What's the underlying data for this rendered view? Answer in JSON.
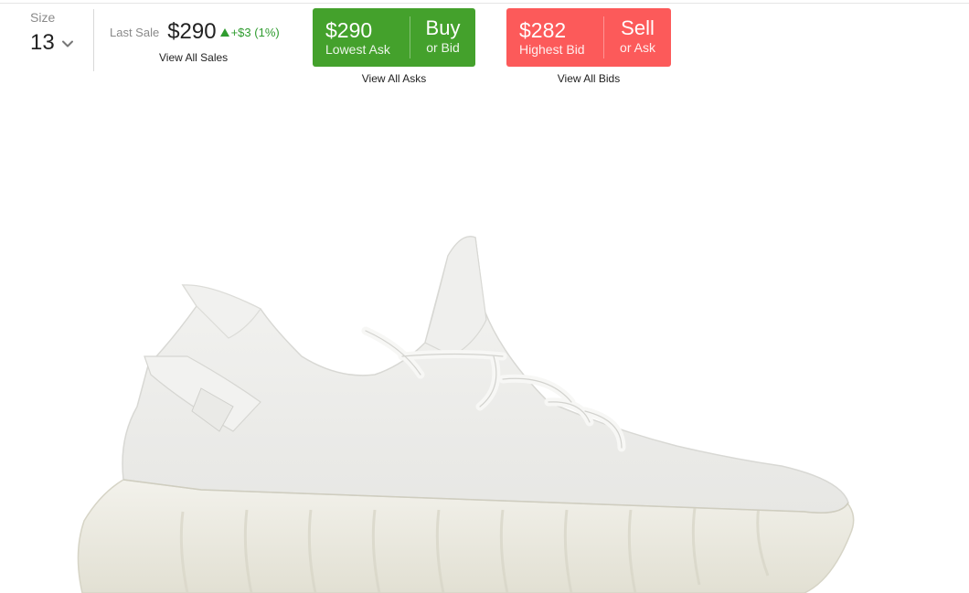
{
  "size": {
    "label": "Size",
    "value": "13",
    "icon": "chevron-down-icon"
  },
  "last_sale": {
    "label": "Last Sale",
    "price": "$290",
    "change": "+$3 (1%)",
    "direction": "up",
    "link": "View All Sales"
  },
  "buy": {
    "price": "$290",
    "price_label": "Lowest Ask",
    "action": "Buy",
    "alt": "or Bid",
    "link": "View All Asks",
    "color": "#44a12c"
  },
  "sell": {
    "price": "$282",
    "price_label": "Highest Bid",
    "action": "Sell",
    "alt": "or Ask",
    "link": "View All Bids",
    "color": "#fc5a5a"
  },
  "colors": {
    "positive": "#2f9c2f",
    "muted": "#8a8a8a",
    "text": "#222222"
  }
}
